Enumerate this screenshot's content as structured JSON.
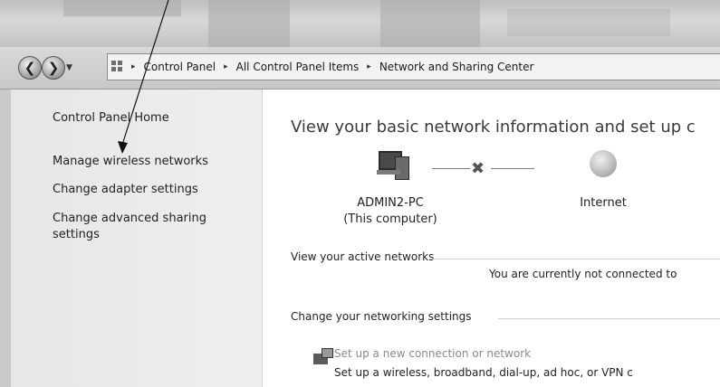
{
  "breadcrumb": {
    "items": [
      "Control Panel",
      "All Control Panel Items",
      "Network and Sharing Center"
    ],
    "separator": "▸"
  },
  "sidebar": {
    "items": [
      {
        "label": "Control Panel Home"
      },
      {
        "label": "Manage wireless networks"
      },
      {
        "label": "Change adapter settings"
      },
      {
        "label": "Change advanced sharing settings"
      }
    ]
  },
  "main": {
    "title": "View your basic network information and set up c",
    "map": {
      "computer_name": "ADMIN2-PC",
      "computer_sub": "(This computer)",
      "internet_label": "Internet"
    },
    "active_networks": {
      "heading": "View your active networks",
      "status": "You are currently not connected to"
    },
    "networking_settings": {
      "heading": "Change your networking settings",
      "setup_link": "Set up a new connection or network",
      "setup_desc": "Set up a wireless, broadband, dial-up, ad hoc, or VPN c"
    }
  },
  "icons": {
    "back": "back-arrow-icon",
    "forward": "forward-arrow-icon",
    "recent": "chevron-down-icon",
    "address": "control-panel-icon",
    "computer": "computer-icon",
    "link_broken": "x-mark-icon",
    "internet": "globe-icon",
    "setup": "network-setup-icon"
  }
}
